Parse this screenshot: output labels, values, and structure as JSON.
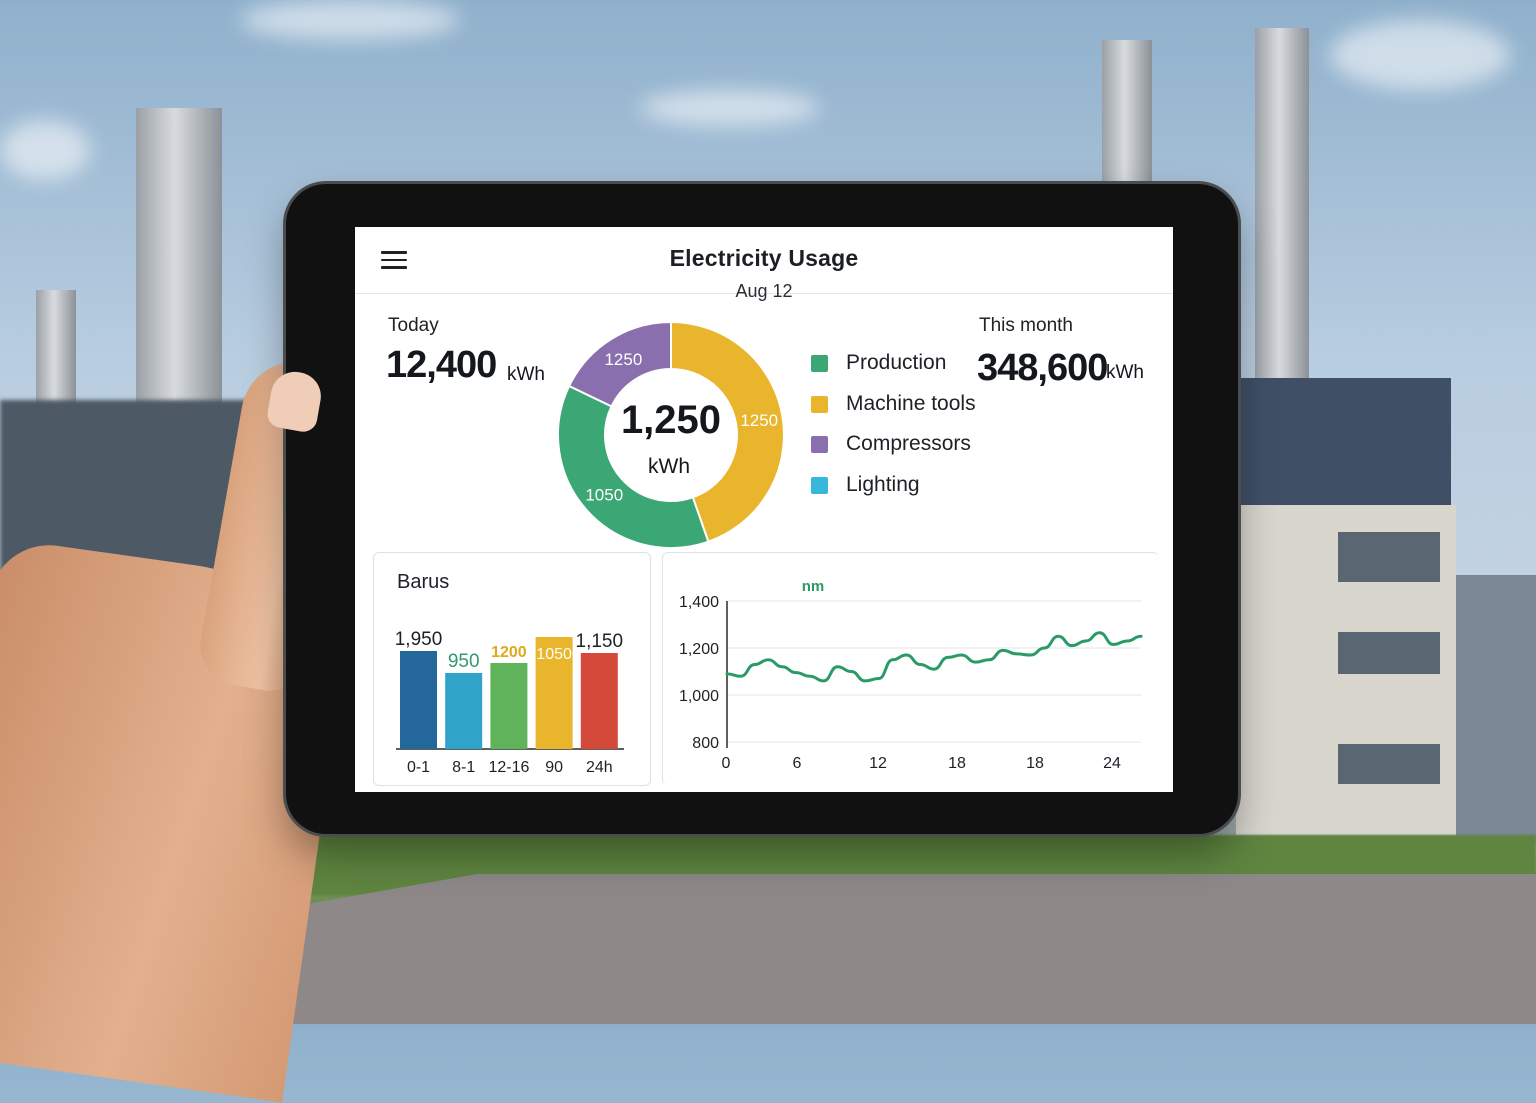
{
  "header": {
    "title": "Electricity Usage",
    "date": "Aug 12"
  },
  "today": {
    "label": "Today",
    "value": "12,400",
    "unit": "kWh"
  },
  "month": {
    "label": "This month",
    "value": "348,600",
    "unit": "kWh"
  },
  "donut": {
    "center_value": "1,250",
    "center_unit": "kWh"
  },
  "legend": [
    {
      "label": "Production",
      "color": "#3aa775"
    },
    {
      "label": "Machine tools",
      "color": "#e8b52c"
    },
    {
      "label": "Compressors",
      "color": "#8a6fae"
    },
    {
      "label": "Lighting",
      "color": "#38b7dd"
    }
  ],
  "bar_panel": {
    "title": "Barus"
  },
  "chart_data": [
    {
      "type": "pie",
      "title": "",
      "slices": [
        {
          "label": "1250",
          "value": 1250,
          "color": "#e8b52c"
        },
        {
          "label": "1050",
          "value": 1050,
          "color": "#3aa775"
        },
        {
          "label": "1250",
          "value": 500,
          "color": "#8a6fae"
        }
      ]
    },
    {
      "type": "bar",
      "title": "Barus",
      "categories": [
        "0-1",
        "8-1",
        "12-16",
        "90",
        "24h"
      ],
      "values": [
        1950,
        950,
        1200,
        1050,
        1150
      ],
      "value_labels": [
        "1,950",
        "950",
        "1200",
        "1050",
        "1,150"
      ],
      "label_colors": [
        "#1d2126",
        "#2f9a6a",
        "#e0a81a",
        "#ffffff",
        "#1d2126"
      ],
      "colors": [
        "#23679b",
        "#2fa4c8",
        "#5fb35a",
        "#e8b52c",
        "#d34a3b"
      ]
    },
    {
      "type": "line",
      "title": "",
      "legend_text": "nm",
      "x_ticks": [
        "0",
        "6",
        "12",
        "18",
        "18",
        "24"
      ],
      "y_ticks": [
        "1,400",
        "1,200",
        "1,000",
        "800"
      ],
      "ylim": [
        800,
        1400
      ],
      "xlim": [
        0,
        24
      ],
      "color": "#2a9a66",
      "x": [
        0,
        0.8,
        1.6,
        2.4,
        3.2,
        4.0,
        4.8,
        5.6,
        6.4,
        7.2,
        8.0,
        8.8,
        9.6,
        10.4,
        11.2,
        12.0,
        12.8,
        13.6,
        14.4,
        15.2,
        16.0,
        16.8,
        17.6,
        18.4,
        19.2,
        20.0,
        20.8,
        21.6,
        22.4,
        23.2,
        24.0
      ],
      "y": [
        1090,
        1080,
        1130,
        1150,
        1120,
        1095,
        1080,
        1060,
        1120,
        1100,
        1060,
        1070,
        1150,
        1170,
        1130,
        1110,
        1160,
        1170,
        1140,
        1150,
        1190,
        1175,
        1170,
        1200,
        1250,
        1210,
        1230,
        1265,
        1215,
        1230,
        1250
      ]
    }
  ]
}
